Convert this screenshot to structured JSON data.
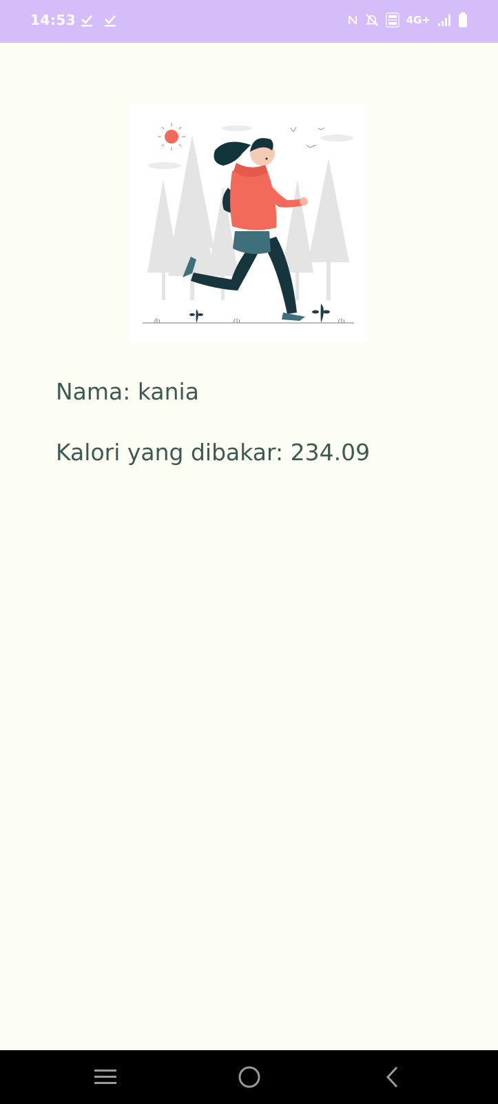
{
  "status_bar": {
    "time": "14:53",
    "network": "4G+",
    "icons": [
      "download-done-icon",
      "download-done-icon",
      "nfc-icon",
      "bell-muted-icon",
      "volte-icon",
      "signal-icon",
      "battery-icon"
    ],
    "color": "#d5bdfa"
  },
  "main": {
    "illustration": "woman-running-illustration",
    "name_line": "Nama: kania",
    "calories_line": "Kalori yang dibakar: 234.09",
    "text_color": "#3d5a52",
    "background": "#fcfef4"
  },
  "nav_bar": {
    "buttons": [
      "recent-apps-icon",
      "home-icon",
      "back-icon"
    ]
  }
}
